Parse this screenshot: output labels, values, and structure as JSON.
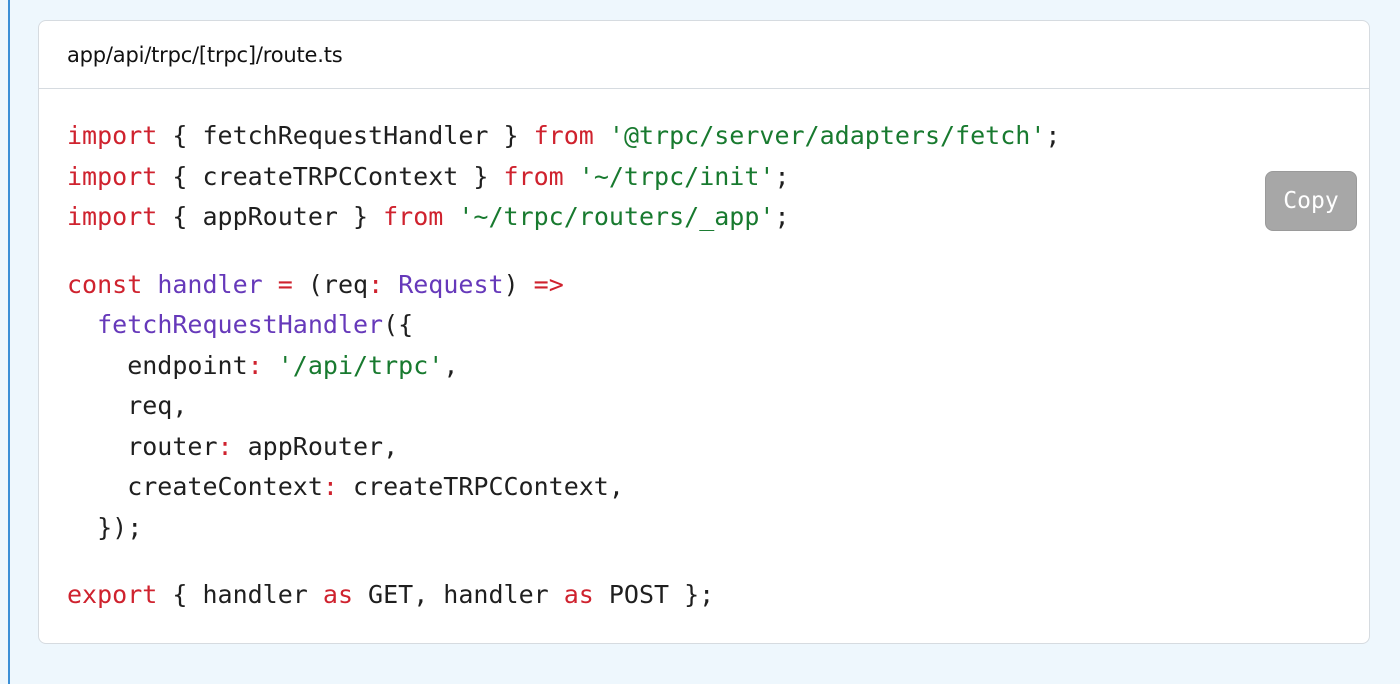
{
  "file": {
    "path": "app/api/trpc/[trpc]/route.ts"
  },
  "toolbar": {
    "copy_label": "Copy"
  },
  "code": {
    "l1": [
      "import",
      " { ",
      "fetchRequestHandler",
      " } ",
      "from",
      " ",
      "'@trpc/server/adapters/fetch'",
      ";"
    ],
    "l2": [
      "import",
      " { ",
      "createTRPCContext",
      " } ",
      "from",
      " ",
      "'~/trpc/init'",
      ";"
    ],
    "l3": [
      "import",
      " { ",
      "appRouter",
      " } ",
      "from",
      " ",
      "'~/trpc/routers/_app'",
      ";"
    ],
    "l4": [
      "const",
      " ",
      "handler",
      " ",
      "=",
      " (req",
      ":",
      " ",
      "Request",
      ") ",
      "=>"
    ],
    "l5": [
      "  ",
      "fetchRequestHandler",
      "({"
    ],
    "l6": [
      "    endpoint",
      ":",
      " ",
      "'/api/trpc'",
      ","
    ],
    "l7": [
      "    req,"
    ],
    "l8": [
      "    router",
      ":",
      " appRouter,"
    ],
    "l9": [
      "    createContext",
      ":",
      " createTRPCContext,"
    ],
    "l10": [
      "  });"
    ],
    "l11": [
      "export",
      " { handler ",
      "as",
      " GET, handler ",
      "as",
      " POST };"
    ]
  },
  "colors": {
    "keyword": "#cf222e",
    "string": "#187a2f",
    "function": "#6639ba",
    "text": "#1f1f1f",
    "copy_button_bg": "#a7a7a7",
    "page_bg": "#eef7fd"
  }
}
